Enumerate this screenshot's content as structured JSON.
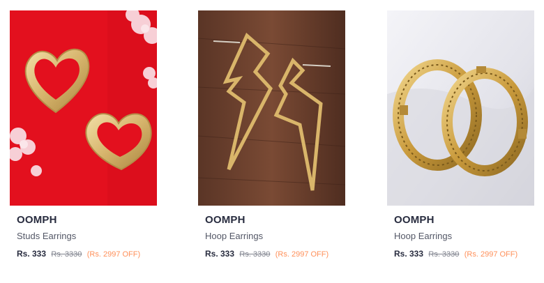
{
  "products": [
    {
      "brand": "OOMPH",
      "name": "Studs Earrings",
      "price": "Rs. 333",
      "mrp": "Rs. 3330",
      "discount": "(Rs. 2997 OFF)",
      "image_bg": "#e3101e"
    },
    {
      "brand": "OOMPH",
      "name": "Hoop Earrings",
      "price": "Rs. 333",
      "mrp": "Rs. 3330",
      "discount": "(Rs. 2997 OFF)",
      "image_bg": "#6b4030"
    },
    {
      "brand": "OOMPH",
      "name": "Hoop Earrings",
      "price": "Rs. 333",
      "mrp": "Rs. 3330",
      "discount": "(Rs. 2997 OFF)",
      "image_bg": "#e8e8ee"
    }
  ],
  "colors": {
    "gold": "#d9b56a",
    "discount": "#ff905a",
    "text": "#282c3f",
    "muted": "#7e818c"
  }
}
